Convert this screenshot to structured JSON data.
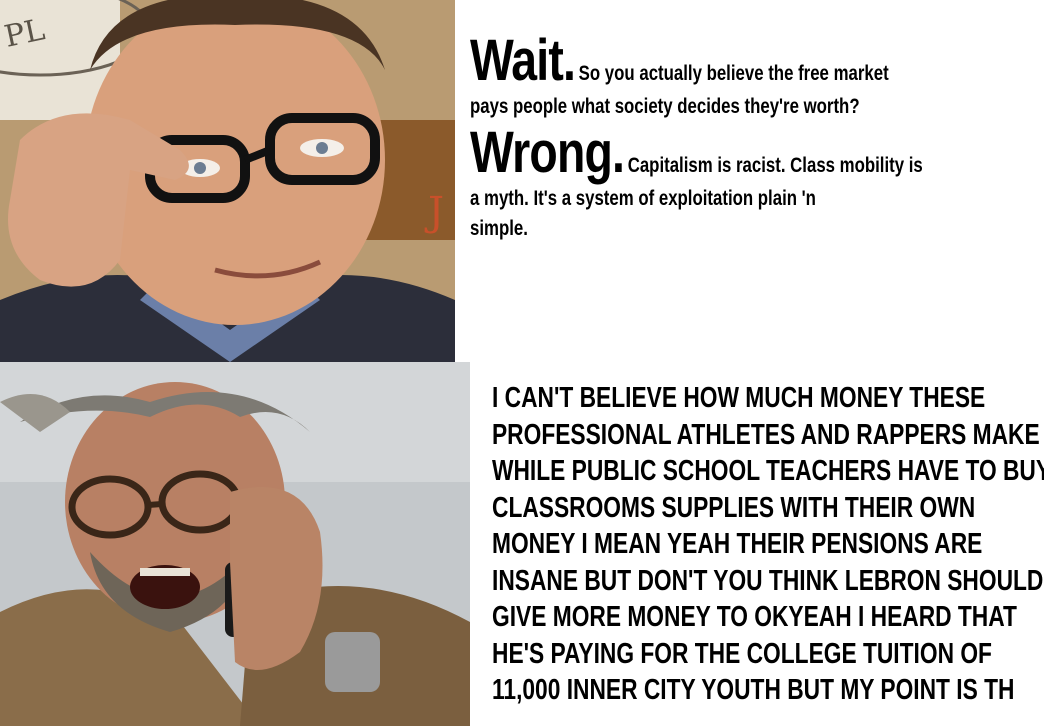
{
  "top_panel": {
    "wait_word": "Wait.",
    "wait_rest_line1": "So you actually believe the free market",
    "line2": "pays people what society decides they're worth?",
    "wrong_word": "Wrong.",
    "wrong_rest_line3": "Capitalism is racist. Class mobility is",
    "line4": "a myth. It's a system of exploitation plain 'n",
    "line5": "simple."
  },
  "bottom_panel": {
    "lines": [
      " I CAN'T BELIEVE HOW MUCH MONEY THESE",
      "PROFESSIONAL ATHLETES AND RAPPERS MAKE",
      "WHILE PUBLIC SCHOOL TEACHERS HAVE TO BUY",
      "CLASSROOMS SUPPLIES WITH THEIR OWN",
      "MONEY I MEAN YEAH THEIR PENSIONS ARE",
      "INSANE BUT DON'T YOU THINK LEBRON SHOULD",
      "GIVE MORE MONEY TO OKYEAH I HEARD THAT",
      "HE'S PAYING FOR THE COLLEGE TUITION OF",
      "11,000 INNER CITY YOUTH BUT MY POINT IS TH"
    ]
  },
  "photos": {
    "top_sign_fragment": "PL",
    "top_sign_letter": "J"
  }
}
